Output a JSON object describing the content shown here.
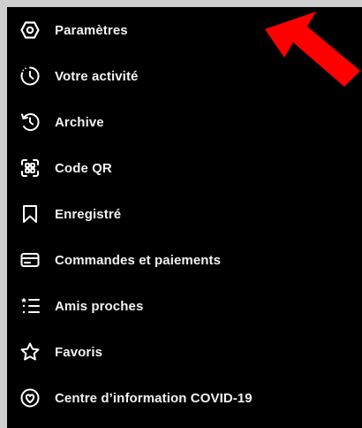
{
  "menu": {
    "items": [
      {
        "label": "Paramètres",
        "icon": "settings-gear-icon"
      },
      {
        "label": "Votre activité",
        "icon": "activity-icon"
      },
      {
        "label": "Archive",
        "icon": "archive-icon"
      },
      {
        "label": "Code QR",
        "icon": "qr-code-icon"
      },
      {
        "label": "Enregistré",
        "icon": "bookmark-icon"
      },
      {
        "label": "Commandes et paiements",
        "icon": "credit-card-icon"
      },
      {
        "label": "Amis proches",
        "icon": "close-friends-list-icon"
      },
      {
        "label": "Favoris",
        "icon": "star-icon"
      },
      {
        "label": "Centre d’information COVID-19",
        "icon": "covid-info-icon"
      }
    ]
  },
  "annotation": {
    "arrow_color": "#ff0000",
    "points_to": "Paramètres"
  }
}
